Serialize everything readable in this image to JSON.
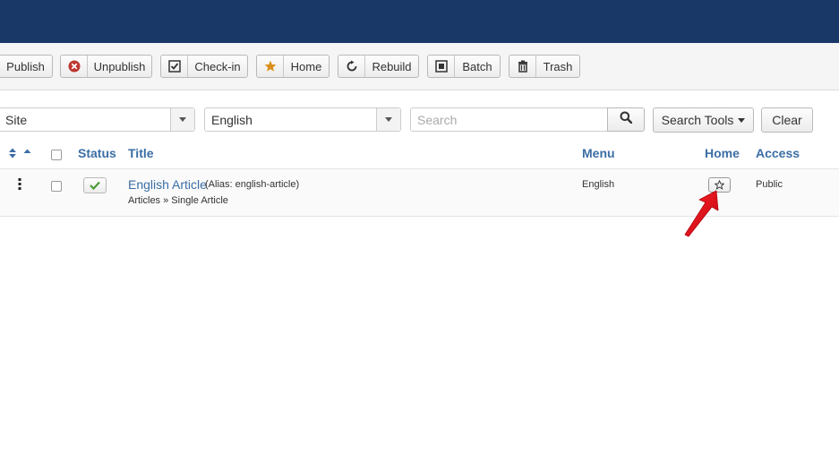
{
  "toolbar": {
    "publish": "Publish",
    "unpublish": "Unpublish",
    "checkin": "Check-in",
    "home": "Home",
    "rebuild": "Rebuild",
    "batch": "Batch",
    "trash": "Trash"
  },
  "filters": {
    "client": "Site",
    "language": "English",
    "search_placeholder": "Search",
    "search_tools": "Search Tools",
    "clear": "Clear"
  },
  "table": {
    "headers": {
      "status": "Status",
      "title": "Title",
      "menu": "Menu",
      "home": "Home",
      "access": "Access"
    },
    "rows": [
      {
        "title": "English Article",
        "alias": "(Alias: english-article)",
        "type": "Articles » Single Article",
        "menu": "English",
        "access": "Public"
      }
    ]
  },
  "colors": {
    "topbar": "#1a3867",
    "link": "#3b6ea5",
    "annotation_arrow": "#e30613",
    "status_check": "#4a9a36"
  },
  "icons": [
    "unpublish-x-icon",
    "checkin-check-icon",
    "home-star-icon",
    "rebuild-refresh-icon",
    "batch-square-icon",
    "trash-icon",
    "search-icon",
    "caret-down-icon",
    "sort-icon",
    "ordering-handle-icon",
    "star-outline-icon"
  ]
}
